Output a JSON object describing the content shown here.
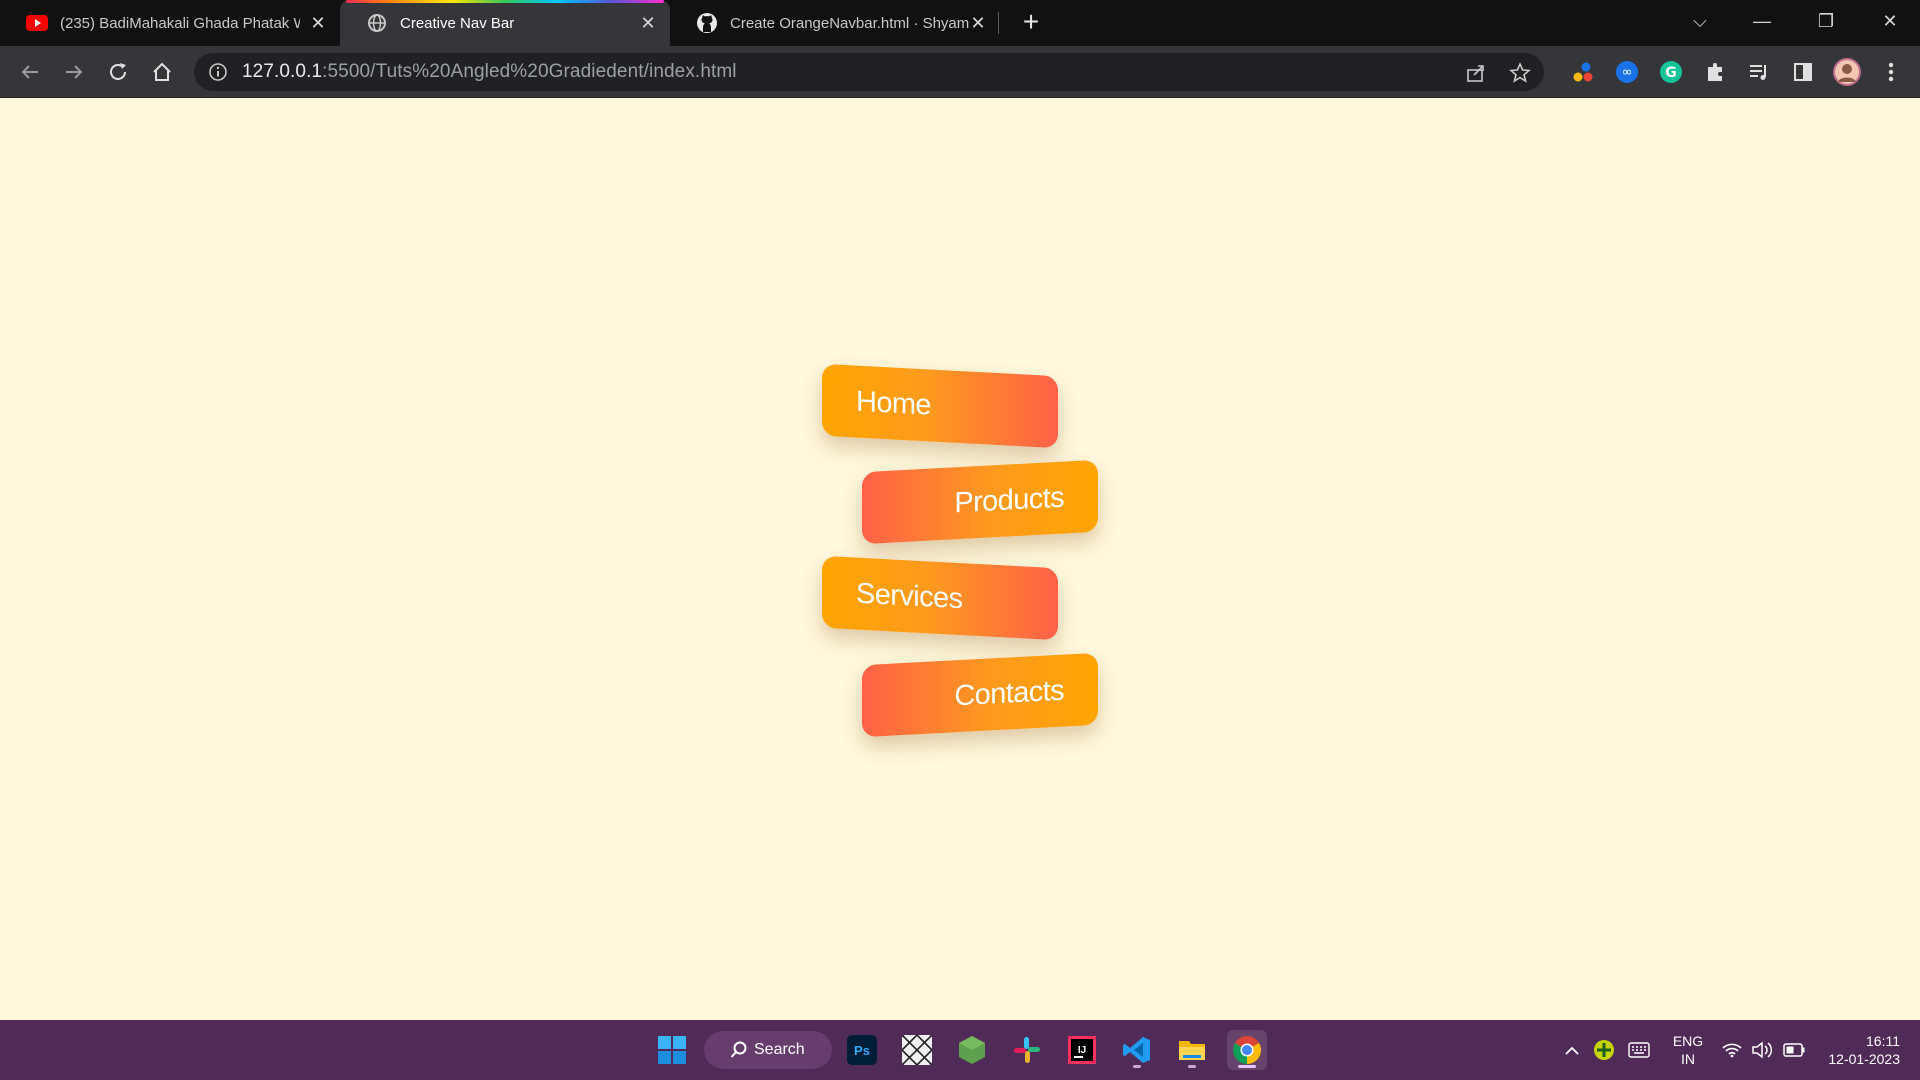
{
  "browser": {
    "tabs": [
      {
        "title": "(235) BadiMahakali Ghada Phatak W",
        "icon": "youtube-icon",
        "active": false
      },
      {
        "title": "Creative Nav Bar",
        "icon": "globe-icon",
        "active": true
      },
      {
        "title": "Create OrangeNavbar.html · Shyam",
        "icon": "github-icon",
        "active": false
      }
    ],
    "new_tab_label": "+",
    "url_host": "127.0.0.1",
    "url_rest": ":5500/Tuts%20Angled%20Gradiedent/index.html"
  },
  "nav": {
    "items": [
      {
        "label": "Home"
      },
      {
        "label": "Products"
      },
      {
        "label": "Services"
      },
      {
        "label": "Contacts"
      }
    ],
    "colors": {
      "gradient_start": "#ffa500",
      "gradient_end": "#ff6147",
      "page_background": "#fff8dc"
    }
  },
  "taskbar": {
    "search_label": "Search",
    "language": {
      "line1": "ENG",
      "line2": "IN"
    },
    "time": "16:11",
    "date": "12-01-2023",
    "apps": [
      "windows-start-icon",
      "photoshop-icon",
      "app-pattern-icon",
      "nodejs-icon",
      "slack-icon",
      "intellij-icon",
      "vscode-icon",
      "file-explorer-icon",
      "chrome-icon"
    ]
  }
}
